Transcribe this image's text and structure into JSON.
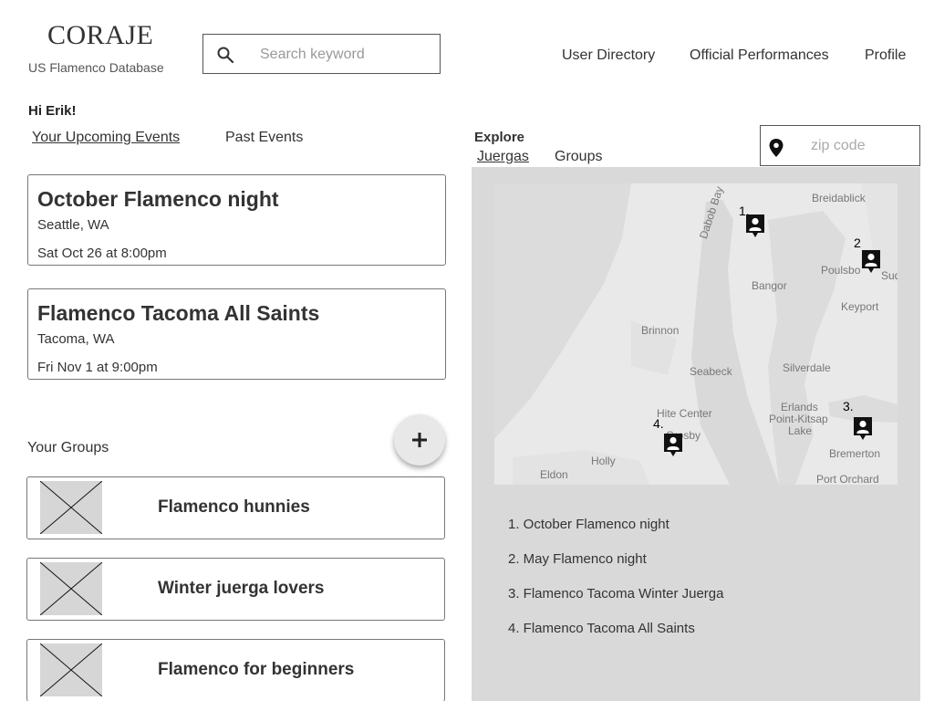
{
  "header": {
    "logo": "CORAJE",
    "tagline": "US Flamenco Database",
    "search_placeholder": "Search keyword",
    "nav": [
      "User Directory",
      "Official Performances",
      "Profile"
    ]
  },
  "greeting": "Hi Erik!",
  "event_tabs": [
    "Your Upcoming Events",
    "Past Events"
  ],
  "events": [
    {
      "title": "October Flamenco night",
      "location": "Seattle, WA",
      "time": "Sat Oct 26 at 8:00pm"
    },
    {
      "title": "Flamenco Tacoma All Saints",
      "location": "Tacoma, WA",
      "time": "Fri Nov 1 at 9:00pm"
    }
  ],
  "groups_label": "Your Groups",
  "groups": [
    "Flamenco hunnies",
    "Winter juerga lovers",
    "Flamenco for beginners"
  ],
  "explore": {
    "label": "Explore",
    "tabs": [
      "Juergas",
      "Groups"
    ],
    "zip_placeholder": "zip code"
  },
  "map": {
    "places": [
      "Breidablick",
      "Dabob Bay",
      "Poulsbo",
      "Suq",
      "Bangor",
      "Keyport",
      "Brinnon",
      "Seabeck",
      "Silverdale",
      "Hite Center",
      "Erlands",
      "Point-Kitsap",
      "Lake",
      "Crosby",
      "Holly",
      "Bremerton",
      "Eldon",
      "Port Orchard"
    ],
    "markers": [
      "1.",
      "2",
      "3.",
      "4."
    ]
  },
  "event_list": [
    "1. October Flamenco night",
    "2. May Flamenco night",
    "3. Flamenco Tacoma Winter Juerga",
    "4. Flamenco Tacoma All Saints"
  ],
  "colors": {
    "panel": "#d9d9d9",
    "map_land": "#e9e9e9",
    "map_water": "#dadada",
    "marker": "#111111"
  }
}
